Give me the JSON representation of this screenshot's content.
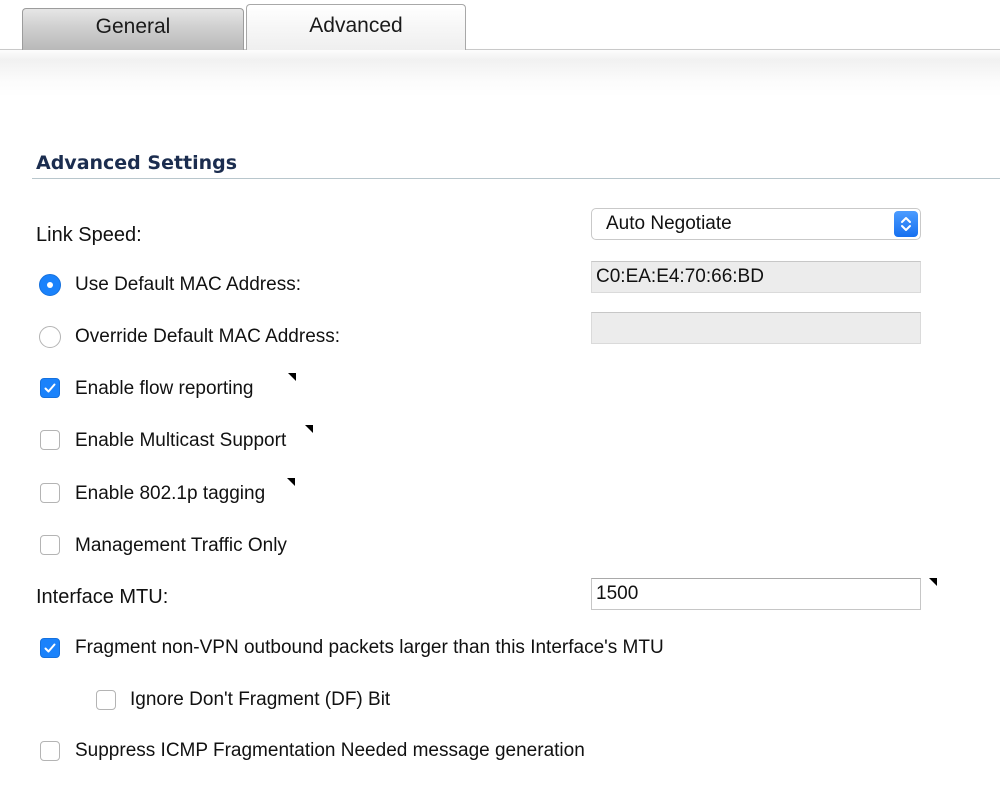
{
  "tabs": [
    {
      "label": "General",
      "active": false
    },
    {
      "label": "Advanced",
      "active": true
    }
  ],
  "section": {
    "title": "Advanced Settings"
  },
  "link_speed": {
    "label": "Link Speed:",
    "value": "Auto Negotiate"
  },
  "mac": {
    "default_label": "Use Default MAC Address:",
    "default_value": "C0:EA:E4:70:66:BD",
    "default_selected": true,
    "override_label": "Override Default MAC Address:",
    "override_value": "",
    "override_selected": false
  },
  "options": {
    "flow_reporting": {
      "label": "Enable flow reporting",
      "checked": true
    },
    "multicast": {
      "label": "Enable Multicast Support",
      "checked": false
    },
    "tagging": {
      "label": "Enable 802.1p tagging",
      "checked": false
    },
    "mgmt_only": {
      "label": "Management Traffic Only",
      "checked": false
    }
  },
  "mtu": {
    "label": "Interface MTU:",
    "value": "1500"
  },
  "fragment": {
    "label": "Fragment non-VPN outbound packets larger than this Interface's MTU",
    "checked": true,
    "ignore_df_label": "Ignore Don't Fragment (DF) Bit",
    "ignore_df_checked": false
  },
  "suppress_icmp": {
    "label": "Suppress ICMP Fragmentation Needed message generation",
    "checked": false
  },
  "colors": {
    "accent": "#1a82fb",
    "section_title": "#1b2d4f"
  }
}
